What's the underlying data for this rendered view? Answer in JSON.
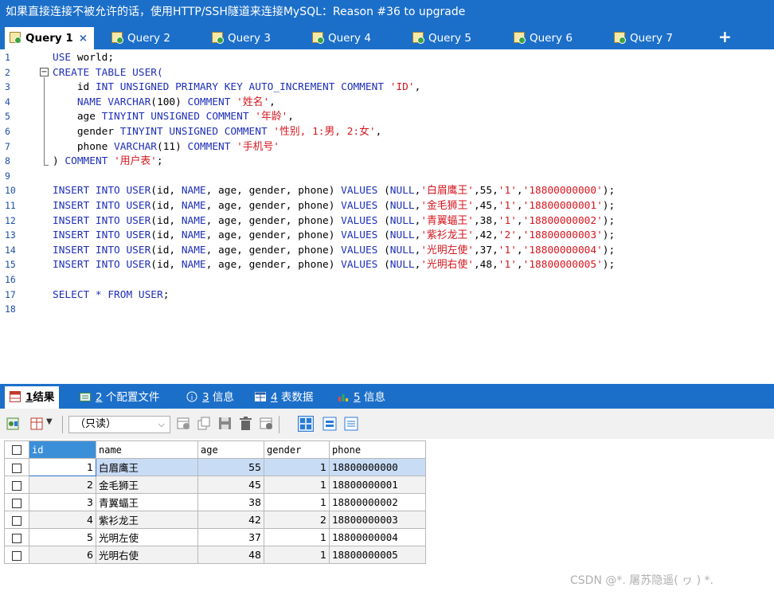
{
  "banner": {
    "text": "如果直接连接不被允许的话，使用HTTP/SSH隧道来连接MySQL：Reason #36 to upgrade"
  },
  "query_tabs": [
    {
      "label": "Query 1",
      "active": true
    },
    {
      "label": "Query 2"
    },
    {
      "label": "Query 3"
    },
    {
      "label": "Query 4"
    },
    {
      "label": "Query 5"
    },
    {
      "label": "Query 6"
    },
    {
      "label": "Query 7"
    }
  ],
  "tab_close": "×",
  "tab_add": "+",
  "editor": {
    "lines": [
      {
        "n": "1",
        "parts": [
          [
            "kw",
            "USE "
          ],
          [
            "plain",
            "world;"
          ]
        ]
      },
      {
        "n": "2",
        "parts": [
          [
            "kw",
            "CREATE TABLE USER("
          ]
        ]
      },
      {
        "n": "3",
        "parts": [
          [
            "plain",
            "    id "
          ],
          [
            "kw",
            "INT UNSIGNED PRIMARY KEY AUTO_INCREMENT COMMENT "
          ],
          [
            "str",
            "'ID'"
          ],
          [
            "plain",
            ","
          ]
        ]
      },
      {
        "n": "4",
        "parts": [
          [
            "kw",
            "    NAME VARCHAR"
          ],
          [
            "plain",
            "(100) "
          ],
          [
            "kw",
            "COMMENT "
          ],
          [
            "str",
            "'姓名'"
          ],
          [
            "plain",
            ","
          ]
        ]
      },
      {
        "n": "5",
        "parts": [
          [
            "plain",
            "    age "
          ],
          [
            "kw",
            "TINYINT UNSIGNED COMMENT "
          ],
          [
            "str",
            "'年龄'"
          ],
          [
            "plain",
            ","
          ]
        ]
      },
      {
        "n": "6",
        "parts": [
          [
            "plain",
            "    gender "
          ],
          [
            "kw",
            "TINYINT UNSIGNED COMMENT "
          ],
          [
            "str",
            "'性别, 1:男, 2:女'"
          ],
          [
            "plain",
            ","
          ]
        ]
      },
      {
        "n": "7",
        "parts": [
          [
            "plain",
            "    phone "
          ],
          [
            "kw",
            "VARCHAR"
          ],
          [
            "plain",
            "(11) "
          ],
          [
            "kw",
            "COMMENT "
          ],
          [
            "str",
            "'手机号'"
          ]
        ]
      },
      {
        "n": "8",
        "parts": [
          [
            "plain",
            ") "
          ],
          [
            "kw",
            "COMMENT "
          ],
          [
            "str",
            "'用户表'"
          ],
          [
            "plain",
            ";"
          ]
        ]
      },
      {
        "n": "9",
        "parts": []
      },
      {
        "n": "10",
        "parts": [
          [
            "kw",
            "INSERT INTO USER"
          ],
          [
            "plain",
            "(id, "
          ],
          [
            "kw",
            "NAME"
          ],
          [
            "plain",
            ", age, gender, phone) "
          ],
          [
            "kw",
            "VALUES "
          ],
          [
            "plain",
            "("
          ],
          [
            "kw",
            "NULL"
          ],
          [
            "plain",
            ","
          ],
          [
            "str",
            "'白眉鹰王'"
          ],
          [
            "plain",
            ",55,"
          ],
          [
            "str",
            "'1'"
          ],
          [
            "plain",
            ","
          ],
          [
            "str",
            "'18800000000'"
          ],
          [
            "plain",
            ");"
          ]
        ]
      },
      {
        "n": "11",
        "parts": [
          [
            "kw",
            "INSERT INTO USER"
          ],
          [
            "plain",
            "(id, "
          ],
          [
            "kw",
            "NAME"
          ],
          [
            "plain",
            ", age, gender, phone) "
          ],
          [
            "kw",
            "VALUES "
          ],
          [
            "plain",
            "("
          ],
          [
            "kw",
            "NULL"
          ],
          [
            "plain",
            ","
          ],
          [
            "str",
            "'金毛狮王'"
          ],
          [
            "plain",
            ",45,"
          ],
          [
            "str",
            "'1'"
          ],
          [
            "plain",
            ","
          ],
          [
            "str",
            "'18800000001'"
          ],
          [
            "plain",
            ");"
          ]
        ]
      },
      {
        "n": "12",
        "parts": [
          [
            "kw",
            "INSERT INTO USER"
          ],
          [
            "plain",
            "(id, "
          ],
          [
            "kw",
            "NAME"
          ],
          [
            "plain",
            ", age, gender, phone) "
          ],
          [
            "kw",
            "VALUES "
          ],
          [
            "plain",
            "("
          ],
          [
            "kw",
            "NULL"
          ],
          [
            "plain",
            ","
          ],
          [
            "str",
            "'青翼蝠王'"
          ],
          [
            "plain",
            ",38,"
          ],
          [
            "str",
            "'1'"
          ],
          [
            "plain",
            ","
          ],
          [
            "str",
            "'18800000002'"
          ],
          [
            "plain",
            ");"
          ]
        ]
      },
      {
        "n": "13",
        "parts": [
          [
            "kw",
            "INSERT INTO USER"
          ],
          [
            "plain",
            "(id, "
          ],
          [
            "kw",
            "NAME"
          ],
          [
            "plain",
            ", age, gender, phone) "
          ],
          [
            "kw",
            "VALUES "
          ],
          [
            "plain",
            "("
          ],
          [
            "kw",
            "NULL"
          ],
          [
            "plain",
            ","
          ],
          [
            "str",
            "'紫衫龙王'"
          ],
          [
            "plain",
            ",42,"
          ],
          [
            "str",
            "'2'"
          ],
          [
            "plain",
            ","
          ],
          [
            "str",
            "'18800000003'"
          ],
          [
            "plain",
            ");"
          ]
        ]
      },
      {
        "n": "14",
        "parts": [
          [
            "kw",
            "INSERT INTO USER"
          ],
          [
            "plain",
            "(id, "
          ],
          [
            "kw",
            "NAME"
          ],
          [
            "plain",
            ", age, gender, phone) "
          ],
          [
            "kw",
            "VALUES "
          ],
          [
            "plain",
            "("
          ],
          [
            "kw",
            "NULL"
          ],
          [
            "plain",
            ","
          ],
          [
            "str",
            "'光明左使'"
          ],
          [
            "plain",
            ",37,"
          ],
          [
            "str",
            "'1'"
          ],
          [
            "plain",
            ","
          ],
          [
            "str",
            "'18800000004'"
          ],
          [
            "plain",
            ");"
          ]
        ]
      },
      {
        "n": "15",
        "parts": [
          [
            "kw",
            "INSERT INTO USER"
          ],
          [
            "plain",
            "(id, "
          ],
          [
            "kw",
            "NAME"
          ],
          [
            "plain",
            ", age, gender, phone) "
          ],
          [
            "kw",
            "VALUES "
          ],
          [
            "plain",
            "("
          ],
          [
            "kw",
            "NULL"
          ],
          [
            "plain",
            ","
          ],
          [
            "str",
            "'光明右使'"
          ],
          [
            "plain",
            ",48,"
          ],
          [
            "str",
            "'1'"
          ],
          [
            "plain",
            ","
          ],
          [
            "str",
            "'18800000005'"
          ],
          [
            "plain",
            ");"
          ]
        ]
      },
      {
        "n": "16",
        "parts": []
      },
      {
        "n": "17",
        "parts": [
          [
            "kw",
            "SELECT * FROM USER"
          ],
          [
            "plain",
            ";"
          ]
        ]
      },
      {
        "n": "18",
        "parts": []
      }
    ]
  },
  "result_tabs": [
    {
      "num": "1",
      "label": "结果",
      "active": true
    },
    {
      "num": "2",
      "label": "个配置文件"
    },
    {
      "num": "3",
      "label": "信息"
    },
    {
      "num": "4",
      "label": "表数据"
    },
    {
      "num": "5",
      "label": "信息"
    }
  ],
  "toolbar": {
    "mode_select": "（只读）",
    "chevron": "⌵"
  },
  "grid": {
    "columns": [
      "id",
      "name",
      "age",
      "gender",
      "phone"
    ],
    "rows": [
      {
        "id": "1",
        "name": "白眉鹰王",
        "age": "55",
        "gender": "1",
        "phone": "18800000000"
      },
      {
        "id": "2",
        "name": "金毛狮王",
        "age": "45",
        "gender": "1",
        "phone": "18800000001"
      },
      {
        "id": "3",
        "name": "青翼蝠王",
        "age": "38",
        "gender": "1",
        "phone": "18800000002"
      },
      {
        "id": "4",
        "name": "紫衫龙王",
        "age": "42",
        "gender": "2",
        "phone": "18800000003"
      },
      {
        "id": "5",
        "name": "光明左使",
        "age": "37",
        "gender": "1",
        "phone": "18800000004"
      },
      {
        "id": "6",
        "name": "光明右使",
        "age": "48",
        "gender": "1",
        "phone": "18800000005"
      }
    ]
  },
  "watermark": "CSDN @*. 屠苏隐遥(  ヮ ) *.",
  "colors": {
    "header_blue": "#1c6fc9",
    "keyword": "#1e2fb8",
    "string": "#d6161e",
    "line_number": "#1c50a8"
  }
}
